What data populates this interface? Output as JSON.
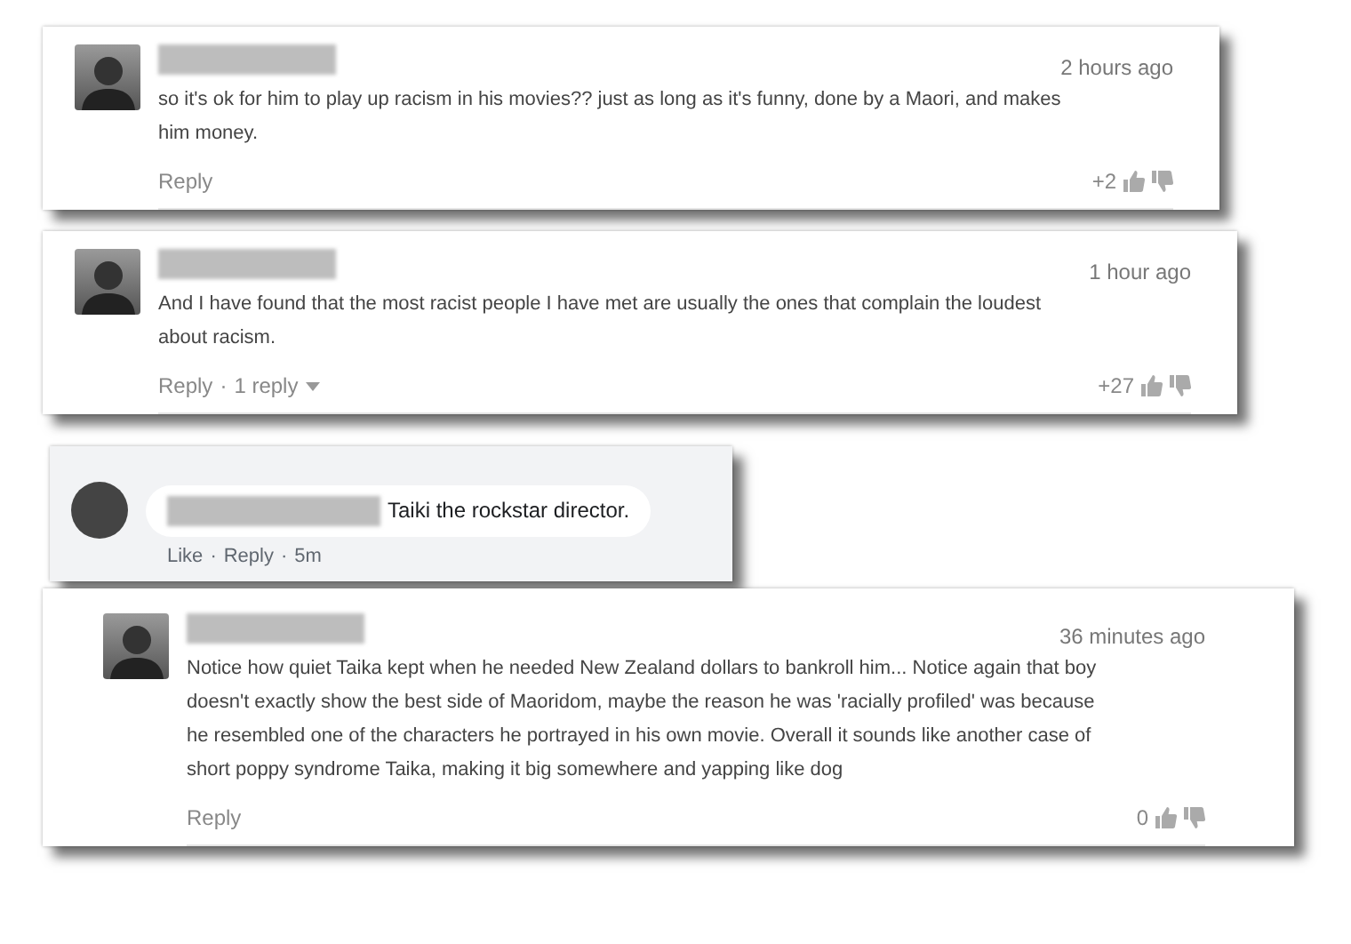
{
  "comments": [
    {
      "kind": "thread",
      "time": "2 hours ago",
      "text": "so it's ok for him to play up racism in his movies?? just as long as it's funny, done by a Maori, and makes him money.",
      "reply": "Reply",
      "score": "+2"
    },
    {
      "kind": "thread",
      "time": "1 hour ago",
      "text": "And  I have found that the most racist people I have met are usually the ones that complain the loudest about racism.",
      "reply": "Reply",
      "separator": "·",
      "replies": "1 reply",
      "score": "+27"
    },
    {
      "kind": "bubble",
      "text": "Taiki the rockstar director.",
      "separator": "·",
      "actions": [
        "Like",
        "Reply",
        "5m"
      ]
    },
    {
      "kind": "thread",
      "time": "36 minutes ago",
      "text": "Notice how quiet Taika kept when he needed New Zealand dollars to bankroll him... Notice again that boy doesn't exactly show the best side of Maoridom, maybe the reason he was 'racially profiled' was because he resembled one of the characters he portrayed in his own movie.  Overall it sounds like another case of short poppy syndrome Taika, making it big somewhere and yapping like dog",
      "reply": "Reply",
      "score": "0"
    }
  ]
}
